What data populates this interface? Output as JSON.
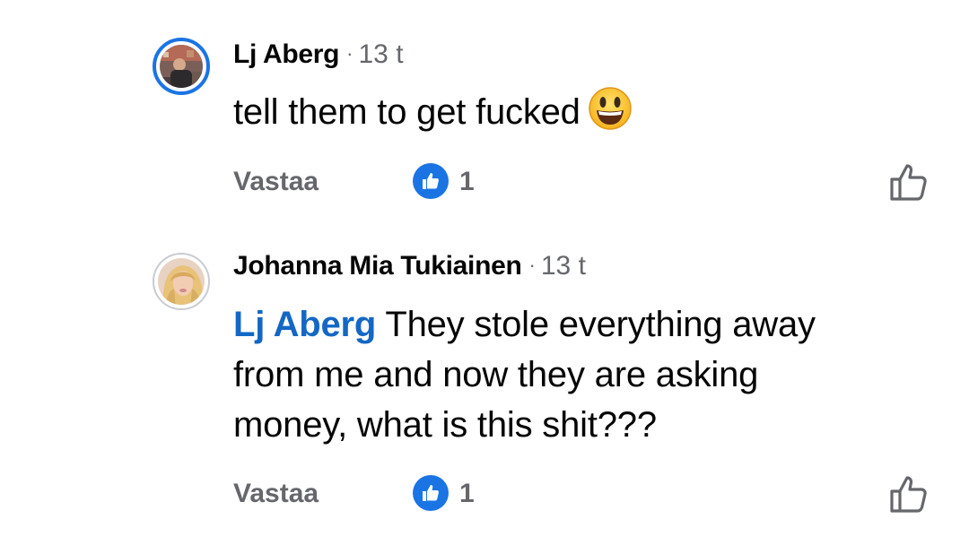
{
  "comments": [
    {
      "author": "Lj Aberg",
      "separator": "·",
      "time": "13 t",
      "text": "tell them to get fucked",
      "emoji": "grinning-face-emoji",
      "reply_label": "Vastaa",
      "like_count": "1",
      "avatar_style": "story-ring"
    },
    {
      "author": "Johanna Mia Tukiainen",
      "separator": "·",
      "time": "13 t",
      "mention": "Lj Aberg",
      "text_line1": " They stole everything away",
      "text_line2": "from me and now they are asking",
      "text_line3": "money, what is this shit???",
      "reply_label": "Vastaa",
      "like_count": "1",
      "avatar_style": "plain-ring"
    }
  ],
  "colors": {
    "accent": "#1b74e4",
    "mention": "#1467c4",
    "meta": "#65676b",
    "text": "#050505"
  },
  "icons": [
    "like-reaction-icon",
    "like-thumb-icon",
    "grinning-face-emoji"
  ]
}
